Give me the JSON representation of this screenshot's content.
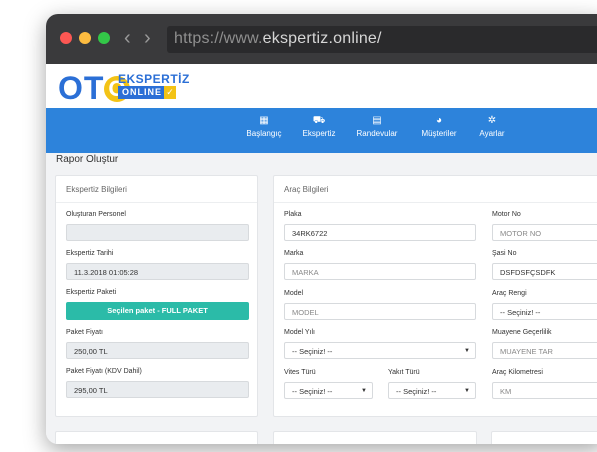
{
  "browser": {
    "url_prefix": "https://www.",
    "url_domain": "ekspertiz.online/",
    "back_arrow": "‹",
    "forward_arrow": "›"
  },
  "logo": {
    "part_ot": "OT",
    "part_o": "O",
    "word1": "EKSPERTİZ",
    "word2": "ONLINE",
    "check": "✓"
  },
  "menu": [
    {
      "icon": "dashboard-icon",
      "glyph": "▦",
      "label": "Başlangıç"
    },
    {
      "icon": "car-icon",
      "glyph": "⛟",
      "label": "Ekspertiz"
    },
    {
      "icon": "calendar-icon",
      "glyph": "▤",
      "label": "Randevular"
    },
    {
      "icon": "users-icon",
      "glyph": "◕",
      "label": "Müşteriler"
    },
    {
      "icon": "gear-icon",
      "glyph": "✲",
      "label": "Ayarlar"
    }
  ],
  "page": {
    "title": "Rapor Oluştur"
  },
  "left_card": {
    "title": "Ekspertiz Bilgileri",
    "personel_label": "Oluşturan Personel",
    "personel_value": "",
    "tarih_label": "Ekspertiz Tarihi",
    "tarih_value": "11.3.2018 01:05:28",
    "paket_label": "Ekspertiz Paketi",
    "paket_button": "Seçilen paket - FULL PAKET",
    "fiyat_label": "Paket Fiyatı",
    "fiyat_value": "250,00 TL",
    "kdv_label": "Paket Fiyatı (KDV Dahil)",
    "kdv_value": "295,00 TL"
  },
  "right_card": {
    "title": "Araç Bilgileri",
    "plaka_label": "Plaka",
    "plaka_value": "34RK6722",
    "marka_label": "Marka",
    "marka_placeholder": "MARKA",
    "model_label": "Model",
    "model_placeholder": "MODEL",
    "model_yili_label": "Model Yılı",
    "model_yili_value": "-- Seçiniz! --",
    "vites_label": "Vites Türü",
    "vites_value": "-- Seçiniz! --",
    "yakit_label": "Yakıt Türü",
    "yakit_value": "-- Seçiniz! --",
    "motor_label": "Motor No",
    "motor_placeholder": "MOTOR NO",
    "sasi_label": "Şasi No",
    "sasi_value": "DSFDSFÇSDFK",
    "renk_label": "Araç Rengi",
    "renk_value": "-- Seçiniz! --",
    "muayene_label": "Muayene Geçerlilik",
    "muayene_placeholder": "MUAYENE TAR",
    "km_label": "Araç Kilometresi",
    "km_placeholder": "KM"
  }
}
